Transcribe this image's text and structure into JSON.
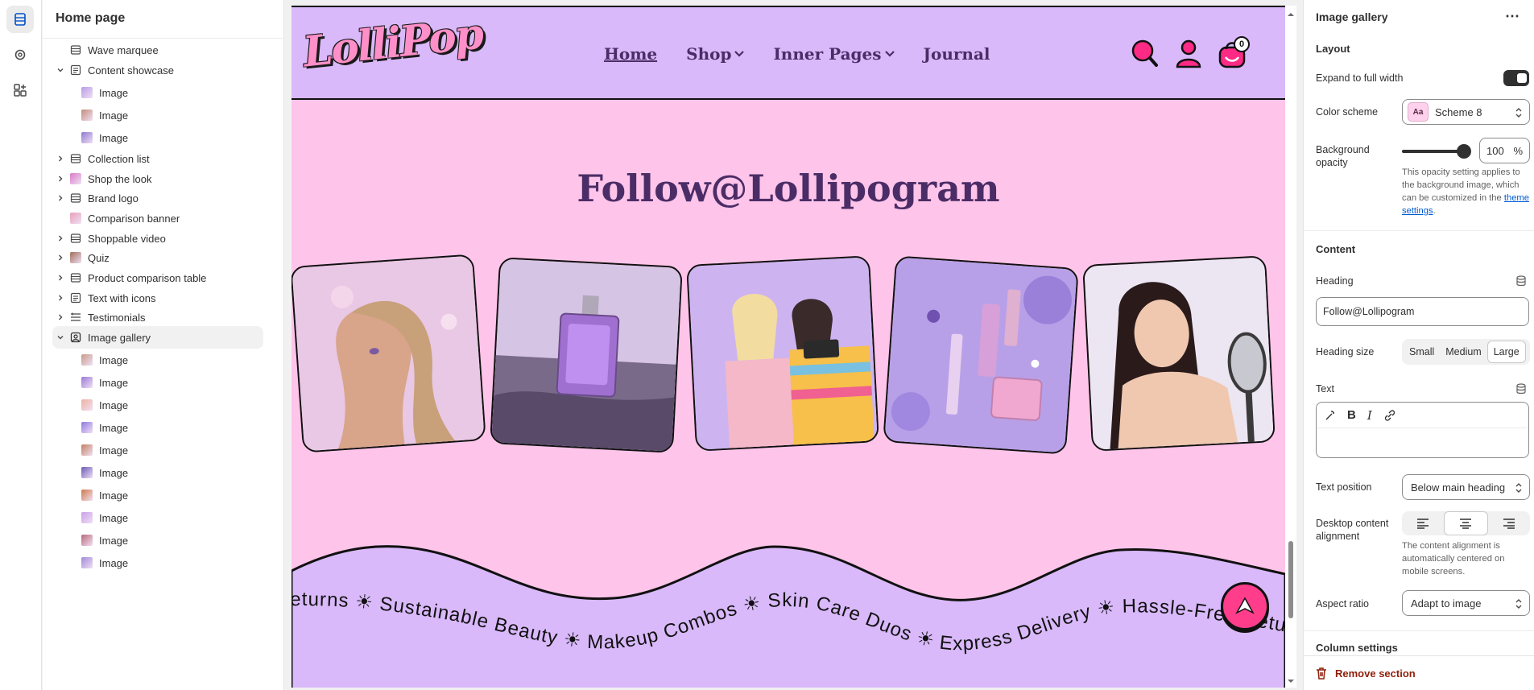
{
  "rail": {
    "items": [
      {
        "icon": "sections-icon",
        "active": true
      },
      {
        "icon": "gear-icon",
        "active": false
      },
      {
        "icon": "apps-icon",
        "active": false
      }
    ]
  },
  "sidebar": {
    "title": "Home page",
    "items": [
      {
        "label": "Wave marquee",
        "level": 0,
        "chevron": "none",
        "icon": "section-icon"
      },
      {
        "label": "Content showcase",
        "level": 0,
        "chevron": "down",
        "icon": "text-section-icon"
      },
      {
        "label": "Image",
        "level": 1,
        "thumb": "#b99be8"
      },
      {
        "label": "Image",
        "level": 1,
        "thumb": "#c38c7a"
      },
      {
        "label": "Image",
        "level": 1,
        "thumb": "#8f7ad0"
      },
      {
        "label": "Collection list",
        "level": 0,
        "chevron": "right",
        "icon": "section-icon"
      },
      {
        "label": "Shop the look",
        "level": 0,
        "chevron": "right",
        "thumb": "#d87ac8"
      },
      {
        "label": "Brand logo",
        "level": 0,
        "chevron": "right",
        "icon": "section-icon"
      },
      {
        "label": "Comparison banner",
        "level": 0,
        "chevron": "none",
        "thumb": "#e8a0b8"
      },
      {
        "label": "Shoppable video",
        "level": 0,
        "chevron": "right",
        "icon": "section-icon"
      },
      {
        "label": "Quiz",
        "level": 0,
        "chevron": "right",
        "thumb": "#a0705a"
      },
      {
        "label": "Product comparison table",
        "level": 0,
        "chevron": "right",
        "icon": "section-icon"
      },
      {
        "label": "Text with icons",
        "level": 0,
        "chevron": "right",
        "icon": "text-section-icon"
      },
      {
        "label": "Testimonials",
        "level": 0,
        "chevron": "right",
        "icon": "list-icon"
      },
      {
        "label": "Image gallery",
        "level": 0,
        "chevron": "down",
        "icon": "gallery-icon",
        "selected": true
      },
      {
        "label": "Image",
        "level": 1,
        "thumb": "#c99a8a"
      },
      {
        "label": "Image",
        "level": 1,
        "thumb": "#9a7ad8"
      },
      {
        "label": "Image",
        "level": 1,
        "thumb": "#f0b0a0"
      },
      {
        "label": "Image",
        "level": 1,
        "thumb": "#8e7ae0"
      },
      {
        "label": "Image",
        "level": 1,
        "thumb": "#c48060"
      },
      {
        "label": "Image",
        "level": 1,
        "thumb": "#6a5ab8"
      },
      {
        "label": "Image",
        "level": 1,
        "thumb": "#d07848"
      },
      {
        "label": "Image",
        "level": 1,
        "thumb": "#c8a0e8"
      },
      {
        "label": "Image",
        "level": 1,
        "thumb": "#b86878"
      },
      {
        "label": "Image",
        "level": 1,
        "thumb": "#a088d8"
      }
    ]
  },
  "preview": {
    "logo": "LolliPop",
    "nav": [
      {
        "label": "Home",
        "dropdown": false
      },
      {
        "label": "Shop",
        "dropdown": true
      },
      {
        "label": "Inner Pages",
        "dropdown": true
      },
      {
        "label": "Journal",
        "dropdown": false
      }
    ],
    "cart_count": "0",
    "heading": "Follow@Lollipogram",
    "marquee_text": "Returns ☀ Sustainable Beauty ☀ Makeup Combos ☀ Skin Care Duos ☀ Express Delivery ☀ Hassle-Free Returns ☀ Sustainable Beauty",
    "colors": {
      "header_bg": "#d9b9fa",
      "body_bg": "#ffc4ea",
      "heading": "#4a2d66",
      "accent": "#ff3d8b"
    }
  },
  "panel": {
    "title": "Image gallery",
    "more": "⋯",
    "layout_heading": "Layout",
    "expand_label": "Expand to full width",
    "expand_on": true,
    "color_scheme_label": "Color scheme",
    "color_scheme_value": "Scheme 8",
    "swatch_text": "Aa",
    "bg_opacity_label": "Background opacity",
    "bg_opacity_value": "100",
    "bg_opacity_unit": "%",
    "opacity_help": "This opacity setting applies to the background image, which can be customized in the",
    "opacity_help_link": "theme settings",
    "content_heading": "Content",
    "heading_label": "Heading",
    "heading_value": "Follow@Lollipogram",
    "heading_size_label": "Heading size",
    "heading_sizes": [
      "Small",
      "Medium",
      "Large"
    ],
    "heading_size_selected": "Large",
    "text_label": "Text",
    "text_position_label": "Text position",
    "text_position_value": "Below main heading",
    "desktop_align_label": "Desktop content alignment",
    "align_selected": "center",
    "align_help": "The content alignment is automatically centered on mobile screens.",
    "aspect_ratio_label": "Aspect ratio",
    "aspect_ratio_value": "Adapt to image",
    "column_settings_heading": "Column settings",
    "remove_label": "Remove section"
  }
}
